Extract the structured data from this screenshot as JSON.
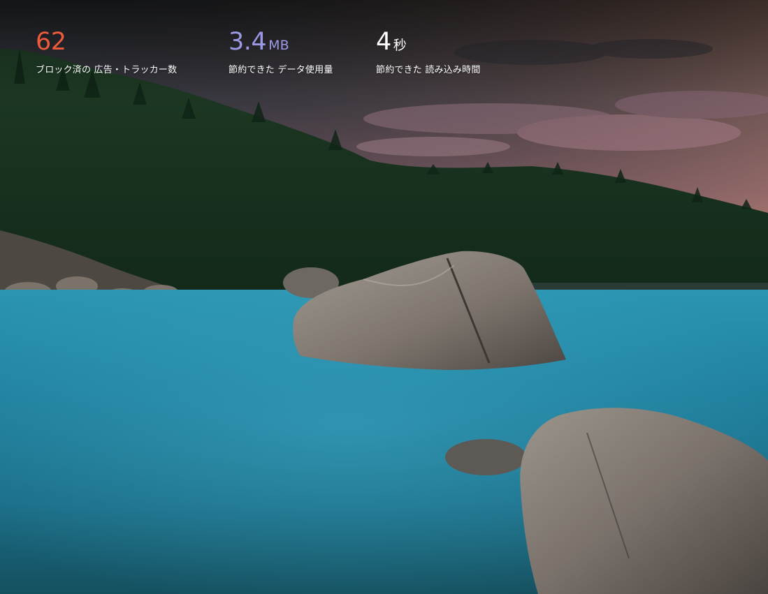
{
  "stats": [
    {
      "value": "62",
      "unit": "",
      "label": "ブロック済の 広告・トラッカー数",
      "color": "#ee5a3c"
    },
    {
      "value": "3.4",
      "unit": "MB",
      "label": "節約できた データ使用量",
      "color": "#9b99e6"
    },
    {
      "value": "4",
      "unit": "秒",
      "label": "節約できた 読み込み時間",
      "color": "#ffffff"
    }
  ],
  "background": {
    "sky_top": "#1f2226",
    "sky_glow": "#c8857c",
    "water": "#1c7a97",
    "forest": "#1c3a22",
    "rock": "#7d7670"
  }
}
